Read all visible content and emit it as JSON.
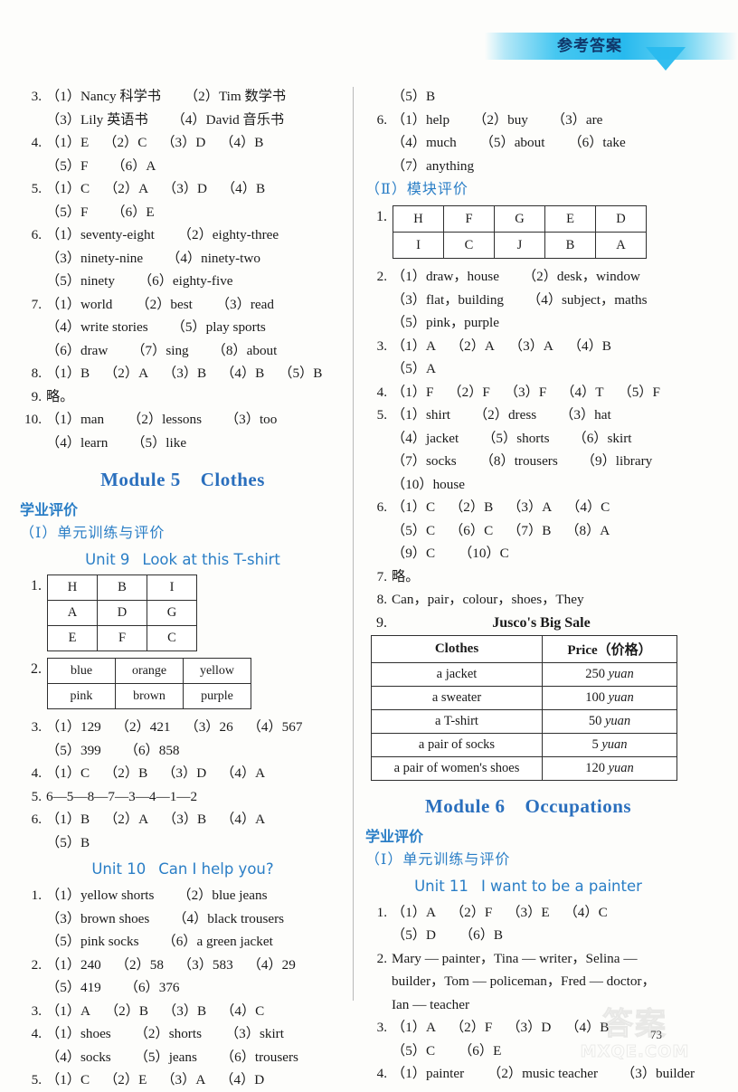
{
  "header": {
    "banner_text": "参考答案"
  },
  "footer": {
    "page_number": "73",
    "watermark_cn": "答案",
    "watermark_en": "MXQE.COM"
  },
  "colors": {
    "heading_blue": "#2a7ec6",
    "module_blue": "#2a6fbd",
    "banner_blue": "#28baee"
  },
  "left_column": {
    "answers_top": [
      {
        "num": "3.",
        "lines": [
          [
            "（1）Nancy 科学书",
            "（2）Tim 数学书"
          ],
          [
            "（3）Lily 英语书",
            "（4）David 音乐书"
          ]
        ]
      },
      {
        "num": "4.",
        "lines": [
          [
            "（1）E",
            "（2）C",
            "（3）D",
            "（4）B"
          ],
          [
            "（5）F",
            "（6）A"
          ]
        ]
      },
      {
        "num": "5.",
        "lines": [
          [
            "（1）C",
            "（2）A",
            "（3）D",
            "（4）B"
          ],
          [
            "（5）F",
            "（6）E"
          ]
        ]
      },
      {
        "num": "6.",
        "lines": [
          [
            "（1）seventy-eight",
            "（2）eighty-three"
          ],
          [
            "（3）ninety-nine",
            "（4）ninety-two"
          ],
          [
            "（5）ninety",
            "（6）eighty-five"
          ]
        ]
      },
      {
        "num": "7.",
        "lines": [
          [
            "（1）world",
            "（2）best",
            "（3）read"
          ],
          [
            "（4）write stories",
            "（5）play sports"
          ],
          [
            "（6）draw",
            "（7）sing",
            "（8）about"
          ]
        ]
      },
      {
        "num": "8.",
        "lines": [
          [
            "（1）B",
            "（2）A",
            "（3）B",
            "（4）B",
            "（5）B"
          ]
        ]
      },
      {
        "num": "9.",
        "lines": [
          [
            "略。"
          ]
        ]
      },
      {
        "num": "10.",
        "lines": [
          [
            "（1）man",
            "（2）lessons",
            "（3）too"
          ],
          [
            "（4）learn",
            "（5）like"
          ]
        ]
      }
    ],
    "module5": {
      "title_label": "Module 5",
      "title_name": "Clothes",
      "cn_head": "学业评价",
      "cn_sub": "（Ⅰ）单元训练与评价",
      "unit_label": "Unit 9",
      "unit_name": "Look at this T-shirt"
    },
    "table1": {
      "num": "1.",
      "rows": [
        [
          "H",
          "B",
          "I"
        ],
        [
          "A",
          "D",
          "G"
        ],
        [
          "E",
          "F",
          "C"
        ]
      ]
    },
    "table2": {
      "num": "2.",
      "rows": [
        [
          "blue",
          "orange",
          "yellow"
        ],
        [
          "pink",
          "brown",
          "purple"
        ]
      ]
    },
    "answers_mid": [
      {
        "num": "3.",
        "lines": [
          [
            "（1）129",
            "（2）421",
            "（3）26",
            "（4）567"
          ],
          [
            "（5）399",
            "（6）858"
          ]
        ]
      },
      {
        "num": "4.",
        "lines": [
          [
            "（1）C",
            "（2）B",
            "（3）D",
            "（4）A"
          ]
        ]
      },
      {
        "num": "5.",
        "lines": [
          [
            "6—5—8—7—3—4—1—2"
          ]
        ]
      },
      {
        "num": "6.",
        "lines": [
          [
            "（1）B",
            "（2）A",
            "（3）B",
            "（4）A"
          ],
          [
            "（5）B"
          ]
        ]
      }
    ],
    "unit10": {
      "unit_label": "Unit 10",
      "unit_name": "Can I help you?"
    },
    "answers_bottom": [
      {
        "num": "1.",
        "lines": [
          [
            "（1）yellow shorts",
            "（2）blue jeans"
          ],
          [
            "（3）brown shoes",
            "（4）black trousers"
          ],
          [
            "（5）pink socks",
            "（6）a green jacket"
          ]
        ]
      },
      {
        "num": "2.",
        "lines": [
          [
            "（1）240",
            "（2）58",
            "（3）583",
            "（4）29"
          ],
          [
            "（5）419",
            "（6）376"
          ]
        ]
      },
      {
        "num": "3.",
        "lines": [
          [
            "（1）A",
            "（2）B",
            "（3）B",
            "（4）C"
          ]
        ]
      },
      {
        "num": "4.",
        "lines": [
          [
            "（1）shoes",
            "（2）shorts",
            "（3）skirt"
          ],
          [
            "（4）socks",
            "（5）jeans",
            "（6）trousers"
          ]
        ]
      },
      {
        "num": "5.",
        "lines": [
          [
            "（1）C",
            "（2）E",
            "（3）A",
            "（4）D"
          ]
        ]
      }
    ]
  },
  "right_column": {
    "answers_top": [
      {
        "num": "",
        "lines": [
          [
            "（5）B"
          ]
        ]
      },
      {
        "num": "6.",
        "lines": [
          [
            "（1）help",
            "（2）buy",
            "（3）are"
          ],
          [
            "（4）much",
            "（5）about",
            "（6）take"
          ],
          [
            "（7）anything"
          ]
        ]
      }
    ],
    "section2_cn": "（Ⅱ）模块评价",
    "table1": {
      "num": "1.",
      "rows": [
        [
          "H",
          "F",
          "G",
          "E",
          "D"
        ],
        [
          "I",
          "C",
          "J",
          "B",
          "A"
        ]
      ]
    },
    "answers_mid": [
      {
        "num": "2.",
        "lines": [
          [
            "（1）draw，house",
            "（2）desk，window"
          ],
          [
            "（3）flat，building",
            "（4）subject，maths"
          ],
          [
            "（5）pink，purple"
          ]
        ]
      },
      {
        "num": "3.",
        "lines": [
          [
            "（1）A",
            "（2）A",
            "（3）A",
            "（4）B"
          ],
          [
            "（5）A"
          ]
        ]
      },
      {
        "num": "4.",
        "lines": [
          [
            "（1）F",
            "（2）F",
            "（3）F",
            "（4）T",
            "（5）F"
          ]
        ]
      },
      {
        "num": "5.",
        "lines": [
          [
            "（1）shirt",
            "（2）dress",
            "（3）hat"
          ],
          [
            "（4）jacket",
            "（5）shorts",
            "（6）skirt"
          ],
          [
            "（7）socks",
            "（8）trousers",
            "（9）library"
          ],
          [
            "（10）house"
          ]
        ]
      },
      {
        "num": "6.",
        "lines": [
          [
            "（1）C",
            "（2）B",
            "（3）A",
            "（4）C"
          ],
          [
            "（5）C",
            "（6）C",
            "（7）B",
            "（8）A"
          ],
          [
            "（9）C",
            "（10）C"
          ]
        ]
      },
      {
        "num": "7.",
        "lines": [
          [
            "略。"
          ]
        ]
      },
      {
        "num": "8.",
        "lines": [
          [
            "Can，pair，colour，shoes，They"
          ]
        ]
      }
    ],
    "sale_table": {
      "num": "9.",
      "title": "Jusco's Big Sale",
      "headers": [
        "Clothes",
        "Price（价格）"
      ],
      "rows": [
        [
          "a jacket",
          "250",
          "yuan"
        ],
        [
          "a sweater",
          "100",
          "yuan"
        ],
        [
          "a T-shirt",
          "50",
          "yuan"
        ],
        [
          "a pair of socks",
          "5",
          "yuan"
        ],
        [
          "a pair of women's shoes",
          "120",
          "yuan"
        ]
      ]
    },
    "module6": {
      "title_label": "Module 6",
      "title_name": "Occupations",
      "cn_head": "学业评价",
      "cn_sub": "（Ⅰ）单元训练与评价",
      "unit_label": "Unit 11",
      "unit_name": "I want to be a painter"
    },
    "answers_bottom": [
      {
        "num": "1.",
        "lines": [
          [
            "（1）A",
            "（2）F",
            "（3）E",
            "（4）C"
          ],
          [
            "（5）D",
            "（6）B"
          ]
        ]
      },
      {
        "num": "2.",
        "lines": [
          [
            "Mary — painter，Tina — writer，Selina —"
          ],
          [
            "builder，Tom — policeman，Fred — doctor，"
          ],
          [
            "Ian — teacher"
          ]
        ]
      },
      {
        "num": "3.",
        "lines": [
          [
            "（1）A",
            "（2）F",
            "（3）D",
            "（4）B"
          ],
          [
            "（5）C",
            "（6）E"
          ]
        ]
      },
      {
        "num": "4.",
        "lines": [
          [
            "（1）painter",
            "（2）music teacher",
            "（3）builder"
          ]
        ]
      }
    ]
  }
}
